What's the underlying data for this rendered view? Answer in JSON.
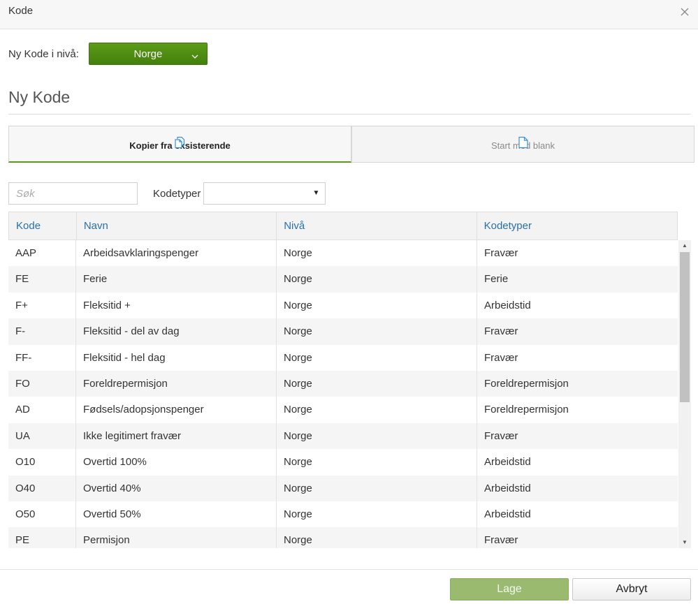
{
  "dialog": {
    "title": "Kode",
    "close_icon": "close-icon"
  },
  "level": {
    "label": "Ny Kode i nivå:",
    "selected": "Norge",
    "accent": "#5a9b16"
  },
  "section": {
    "title": "Ny Kode"
  },
  "tabs": [
    {
      "label": "Kopier fra eksisterende",
      "icon": "copy-documents-icon",
      "active": true
    },
    {
      "label": "Start med blank",
      "icon": "blank-document-icon",
      "active": false
    }
  ],
  "filters": {
    "search_placeholder": "Søk",
    "search_value": "",
    "codetype_label": "Kodetyper",
    "codetype_selected": ""
  },
  "table": {
    "headers": [
      "Kode",
      "Navn",
      "Nivå",
      "Kodetyper"
    ],
    "rows": [
      [
        "AAP",
        "Arbeidsavklaringspenger",
        "Norge",
        "Fravær"
      ],
      [
        "FE",
        "Ferie",
        "Norge",
        "Ferie"
      ],
      [
        "F+",
        "Fleksitid +",
        "Norge",
        "Arbeidstid"
      ],
      [
        "F-",
        "Fleksitid - del av dag",
        "Norge",
        "Fravær"
      ],
      [
        "FF-",
        "Fleksitid - hel dag",
        "Norge",
        "Fravær"
      ],
      [
        "FO",
        "Foreldrepermisjon",
        "Norge",
        "Foreldrepermisjon"
      ],
      [
        "AD",
        "Fødsels/adopsjonspenger",
        "Norge",
        "Foreldrepermisjon"
      ],
      [
        "UA",
        "Ikke legitimert fravær",
        "Norge",
        "Fravær"
      ],
      [
        "O10",
        "Overtid 100%",
        "Norge",
        "Arbeidstid"
      ],
      [
        "O40",
        "Overtid 40%",
        "Norge",
        "Arbeidstid"
      ],
      [
        "O50",
        "Overtid 50%",
        "Norge",
        "Arbeidstid"
      ],
      [
        "PE",
        "Permisjon",
        "Norge",
        "Fravær"
      ]
    ]
  },
  "footer": {
    "create_label": "Lage",
    "cancel_label": "Avbryt"
  }
}
